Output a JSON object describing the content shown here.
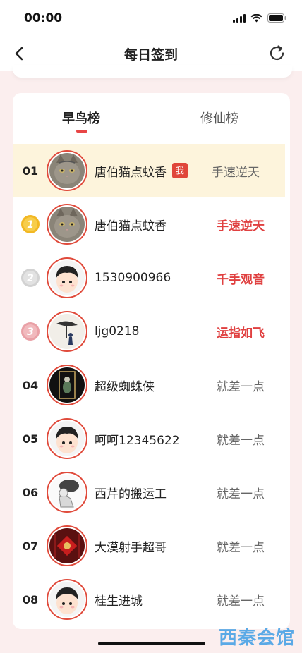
{
  "status_bar": {
    "time": "00:00"
  },
  "nav": {
    "title": "每日签到"
  },
  "tabs": [
    {
      "label": "早鸟榜",
      "active": true
    },
    {
      "label": "修仙榜",
      "active": false
    }
  ],
  "me_badge": "我",
  "rows": [
    {
      "rank": "01",
      "name": "唐伯猫点蚊香",
      "title": "手速逆天",
      "is_me": true,
      "avatar": "cat-avatar"
    },
    {
      "rank": "1",
      "medal": "gold",
      "name": "唐伯猫点蚊香",
      "title": "手速逆天",
      "title_color": "#e04040",
      "avatar": "cat-avatar"
    },
    {
      "rank": "2",
      "medal": "silver",
      "name": "1530900966",
      "title": "千手观音",
      "title_color": "#e04040",
      "avatar": "cartoon-avatar"
    },
    {
      "rank": "3",
      "medal": "bronze",
      "name": "ljg0218",
      "title": "运指如飞",
      "title_color": "#e04040",
      "avatar": "ink-avatar"
    },
    {
      "rank": "04",
      "name": "超级蜘蛛侠",
      "title": "就差一点",
      "avatar": "dark-avatar"
    },
    {
      "rank": "05",
      "name": "呵呵12345622",
      "title": "就差一点",
      "avatar": "cartoon-avatar"
    },
    {
      "rank": "06",
      "name": "西芹的搬运工",
      "title": "就差一点",
      "avatar": "figure-avatar"
    },
    {
      "rank": "07",
      "name": "大漠射手超哥",
      "title": "就差一点",
      "avatar": "fu-avatar"
    },
    {
      "rank": "08",
      "name": "桂生进城",
      "title": "就差一点",
      "avatar": "cartoon-avatar"
    }
  ],
  "watermark": "西秦会馆",
  "colors": {
    "accent": "#e84545",
    "gold": "#f2b824",
    "silver": "#cccccc",
    "bronze": "#e9a0a6"
  }
}
